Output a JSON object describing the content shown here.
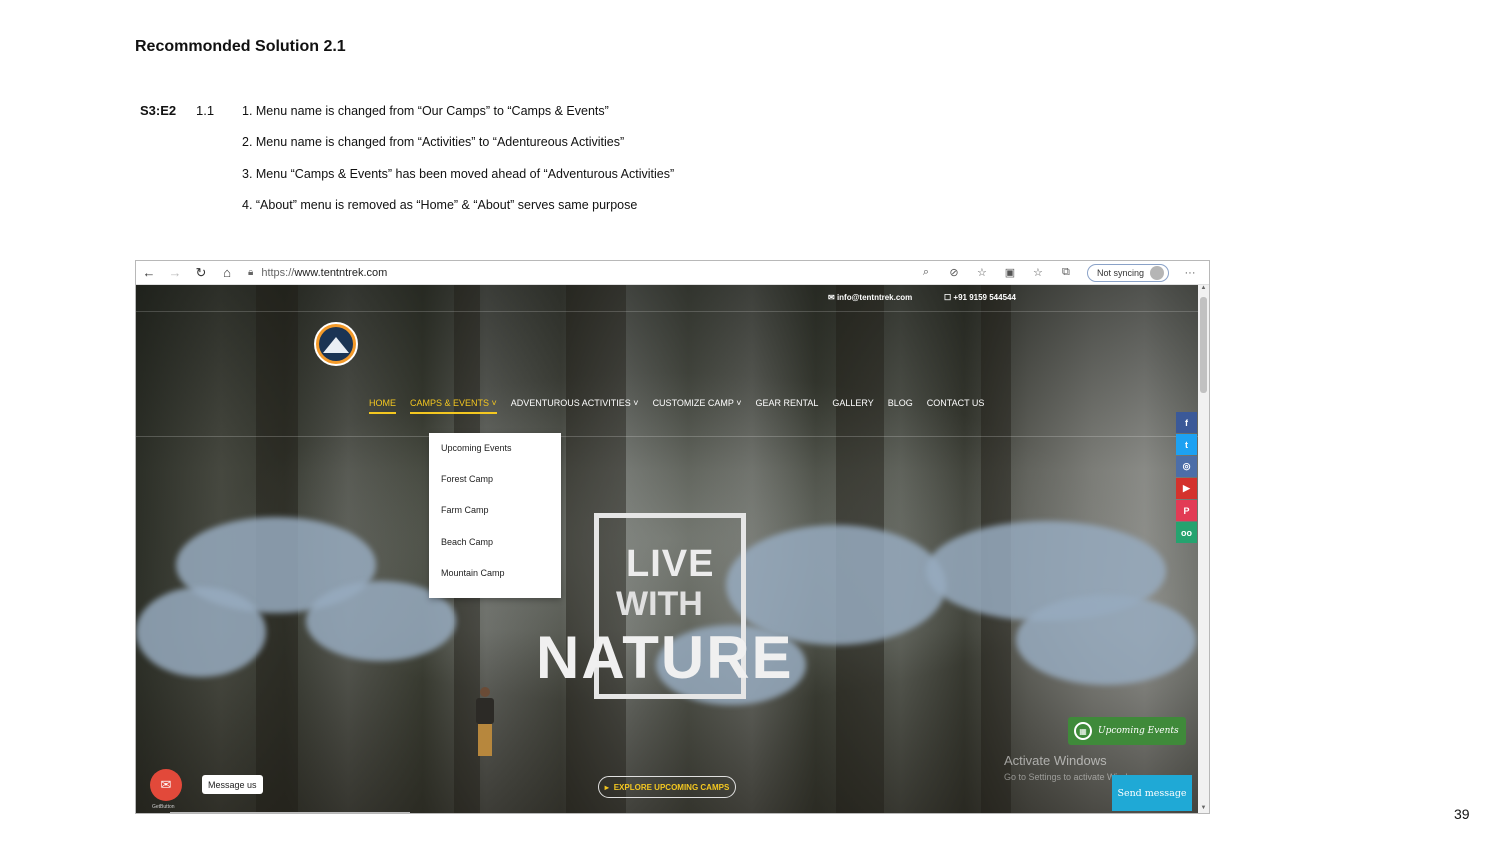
{
  "slide": {
    "title": "Recommonded Solution 2.1",
    "ref_code": "S3:E2",
    "ref_num": "1.1",
    "changes": [
      "1. Menu name is changed from “Our Camps” to “Camps  & Events”",
      "2. Menu name is changed from “Activities” to “Adentureous Activities”",
      "3. Menu “Camps & Events” has been moved ahead of “Adventurous Activities”",
      "4. “About”  menu is removed as “Home” & “About” serves same purpose"
    ],
    "page_number": "39"
  },
  "browser": {
    "url_protocol": "https://",
    "url_host": "www.tentntrek.com",
    "sync_label": "Not syncing",
    "icons": {
      "back": "←",
      "forward": "→",
      "reload": "↻",
      "home": "⌂",
      "lock": "🔒︎",
      "zoom": "⌕",
      "tracking": "⊘",
      "favorite_add": "☆",
      "extensions": "▣",
      "favorites": "☆",
      "collections": "⧉",
      "more": "···"
    }
  },
  "site": {
    "email": "info@tentntrek.com",
    "phone": "+91 9159 544544",
    "nav": [
      {
        "label": "HOME",
        "active": true
      },
      {
        "label": "CAMPS & EVENTS ˅",
        "active": true
      },
      {
        "label": "ADVENTUROUS ACTIVITIES ˅",
        "active": false
      },
      {
        "label": "CUSTOMIZE CAMP ˅",
        "active": false
      },
      {
        "label": "GEAR RENTAL",
        "active": false
      },
      {
        "label": "GALLERY",
        "active": false
      },
      {
        "label": "BLOG",
        "active": false
      },
      {
        "label": "CONTACT US",
        "active": false
      }
    ],
    "dropdown": [
      "Upcoming Events",
      "Forest Camp",
      "Farm Camp",
      "Beach Camp",
      "Mountain Camp"
    ],
    "hero": {
      "line1": "LIVE",
      "line2": "WITH",
      "line3": "NATURE"
    },
    "explore_label": "EXPLORE UPCOMING CAMPS",
    "upcoming_badge": "Upcoming Events",
    "social": [
      {
        "name": "facebook",
        "glyph": "f",
        "color": "#3b5998"
      },
      {
        "name": "twitter",
        "glyph": "t",
        "color": "#1da1f2"
      },
      {
        "name": "instagram",
        "glyph": "◎",
        "color": "#4c6ea8"
      },
      {
        "name": "youtube",
        "glyph": "▶",
        "color": "#d4322c"
      },
      {
        "name": "pinterest",
        "glyph": "P",
        "color": "#e23b55"
      },
      {
        "name": "tripadvisor",
        "glyph": "oo",
        "color": "#25a36f"
      }
    ],
    "watermark_title": "Activate Windows",
    "watermark_sub": "Go to Settings to activate Windows.",
    "message_tip": "Message us",
    "getbutton": "GetButton",
    "send_message": "Send message"
  }
}
